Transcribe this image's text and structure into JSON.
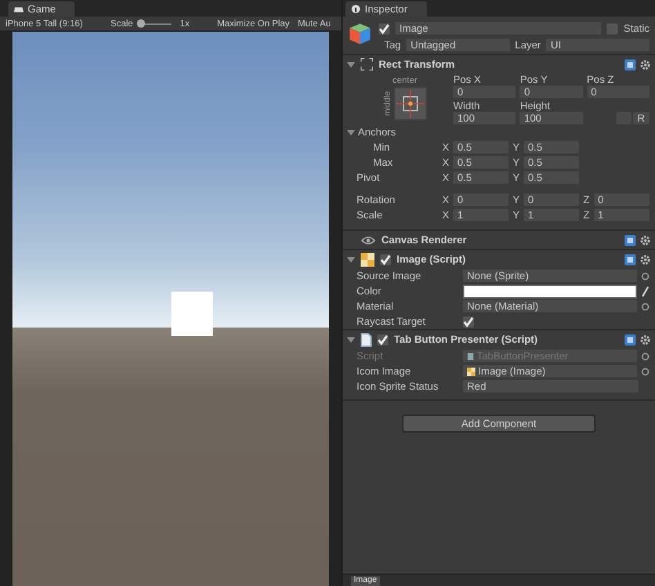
{
  "game": {
    "tab": "Game",
    "resolution": "iPhone 5 Tall (9:16)",
    "scale_label": "Scale",
    "scale_slider": {
      "level": 0
    },
    "scale_value": "1x",
    "maximize_on_play": "Maximize On Play",
    "mute_audio": "Mute Au"
  },
  "inspector": {
    "tab": "Inspector",
    "object": {
      "active": true,
      "name": "Image",
      "static_label": "Static",
      "static": false,
      "tag_label": "Tag",
      "tag": "Untagged",
      "layer_label": "Layer",
      "layer": "UI"
    },
    "rect_transform": {
      "title": "Rect Transform",
      "expanded": true,
      "anchor_h": "center",
      "anchor_v": "middle",
      "pos": [
        {
          "label": "Pos X",
          "value": "0"
        },
        {
          "label": "Pos Y",
          "value": "0"
        },
        {
          "label": "Pos Z",
          "value": "0"
        }
      ],
      "size": [
        {
          "label": "Width",
          "value": "100"
        },
        {
          "label": "Height",
          "value": "100"
        }
      ],
      "raw_button": "R",
      "anchors": {
        "label": "Anchors",
        "expanded": true,
        "children": [
          {
            "label": "Min",
            "values": [
              {
                "axis": "X",
                "value": "0.5"
              },
              {
                "axis": "Y",
                "value": "0.5"
              }
            ]
          },
          {
            "label": "Max",
            "values": [
              {
                "axis": "X",
                "value": "0.5"
              },
              {
                "axis": "Y",
                "value": "0.5"
              }
            ]
          }
        ]
      },
      "pivot": {
        "label": "Pivot",
        "values": [
          {
            "axis": "X",
            "value": "0.5"
          },
          {
            "axis": "Y",
            "value": "0.5"
          }
        ]
      },
      "transform": [
        {
          "label": "Rotation",
          "values": [
            {
              "axis": "X",
              "value": "0"
            },
            {
              "axis": "Y",
              "value": "0"
            },
            {
              "axis": "Z",
              "value": "0"
            }
          ]
        },
        {
          "label": "Scale",
          "values": [
            {
              "axis": "X",
              "value": "1"
            },
            {
              "axis": "Y",
              "value": "1"
            },
            {
              "axis": "Z",
              "value": "1"
            }
          ]
        }
      ]
    },
    "components": [
      {
        "kind": "eye",
        "title": "Canvas Renderer"
      },
      {
        "kind": "image",
        "title": "Image (Script)",
        "enabled": true,
        "expanded": true,
        "fields": [
          {
            "kind": "object",
            "label": "Source Image",
            "value": "None (Sprite)"
          },
          {
            "kind": "color",
            "label": "Color",
            "color": "#ffffff"
          },
          {
            "kind": "object",
            "label": "Material",
            "value": "None (Material)"
          },
          {
            "kind": "toggle",
            "label": "Raycast Target",
            "checked": true
          }
        ]
      },
      {
        "kind": "script",
        "title": "Tab Button Presenter (Script)",
        "enabled": true,
        "expanded": true,
        "fields": [
          {
            "kind": "script",
            "label": "Script",
            "value": "TabButtonPresenter",
            "disabled": true
          },
          {
            "kind": "image_ref",
            "label": "Icom Image",
            "value": "Image (Image)"
          },
          {
            "kind": "dropdown",
            "label": "Icon Sprite Status",
            "value": "Red"
          }
        ]
      }
    ],
    "add_component": "Add Component",
    "preview_label": "Image"
  }
}
